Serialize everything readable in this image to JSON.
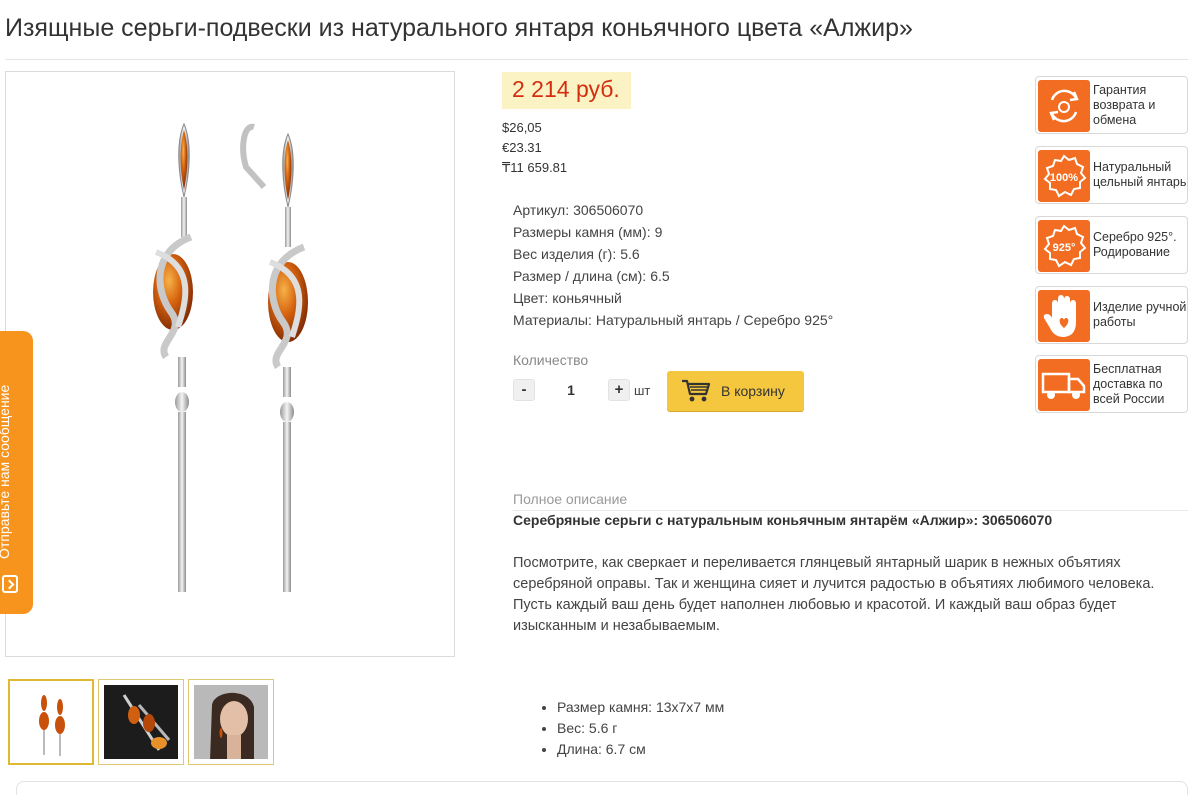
{
  "product": {
    "title": "Изящные серьги-подвески из натурального янтаря коньячного цвета «Алжир»"
  },
  "price": {
    "main": "2 214 руб.",
    "usd": "$26,05",
    "eur": "€23.31",
    "kzt": "₸11 659.81"
  },
  "specs": [
    {
      "label": "Артикул:",
      "value": "306506070"
    },
    {
      "label": "Размеры камня (мм):",
      "value": "9"
    },
    {
      "label": "Вес изделия (г):",
      "value": "5.6"
    },
    {
      "label": "Размер / длина (см):",
      "value": "6.5"
    },
    {
      "label": "Цвет:",
      "value": "коньячный"
    },
    {
      "label": "Материалы:",
      "value": "Натуральный янтарь / Серебро 925°"
    }
  ],
  "quantity": {
    "label": "Количество",
    "minus": "-",
    "value": "1",
    "plus": "+",
    "unit": "шт"
  },
  "cart": {
    "button_label": "В корзину"
  },
  "description": {
    "heading": "Полное описание",
    "subtitle": "Серебряные серьги с натуральным коньячным янтарём «Алжир»: 306506070",
    "paragraphs": [
      "Посмотрите, как сверкает и переливается глянцевый янтарный шарик в нежных объятиях серебряной оправы. Так и женщина сияет и лучится радостью в объятиях любимого человека.",
      "Пусть каждый ваш день будет наполнен любовью и красотой. И каждый ваш образ будет изысканным и незабываемым."
    ],
    "bullets": [
      "Размер камня: 13х7х7 мм",
      "Вес: 5.6 г",
      "Длина: 6.7 см"
    ]
  },
  "benefits": [
    {
      "text": "Гарантия возврата и обмена",
      "icon": "return-guarantee-icon"
    },
    {
      "text": "Натуральный цельный янтарь",
      "icon": "100-percent-badge-icon",
      "badge": "100%"
    },
    {
      "text": "Серебро 925°. Родирование",
      "icon": "silver-925-badge-icon",
      "badge": "925°"
    },
    {
      "text": "Изделие ручной работы",
      "icon": "handmade-hand-icon"
    },
    {
      "text": "Бесплатная доставка по всей России",
      "icon": "delivery-truck-icon"
    }
  ],
  "feedback": {
    "label": "Отправьте нам сообщение"
  },
  "colors": {
    "price_text": "#d42e12",
    "price_bg": "#fbf3c3",
    "accent_orange": "#f26d21",
    "cart_button": "#f5c73e",
    "amber": "#c8500a"
  }
}
